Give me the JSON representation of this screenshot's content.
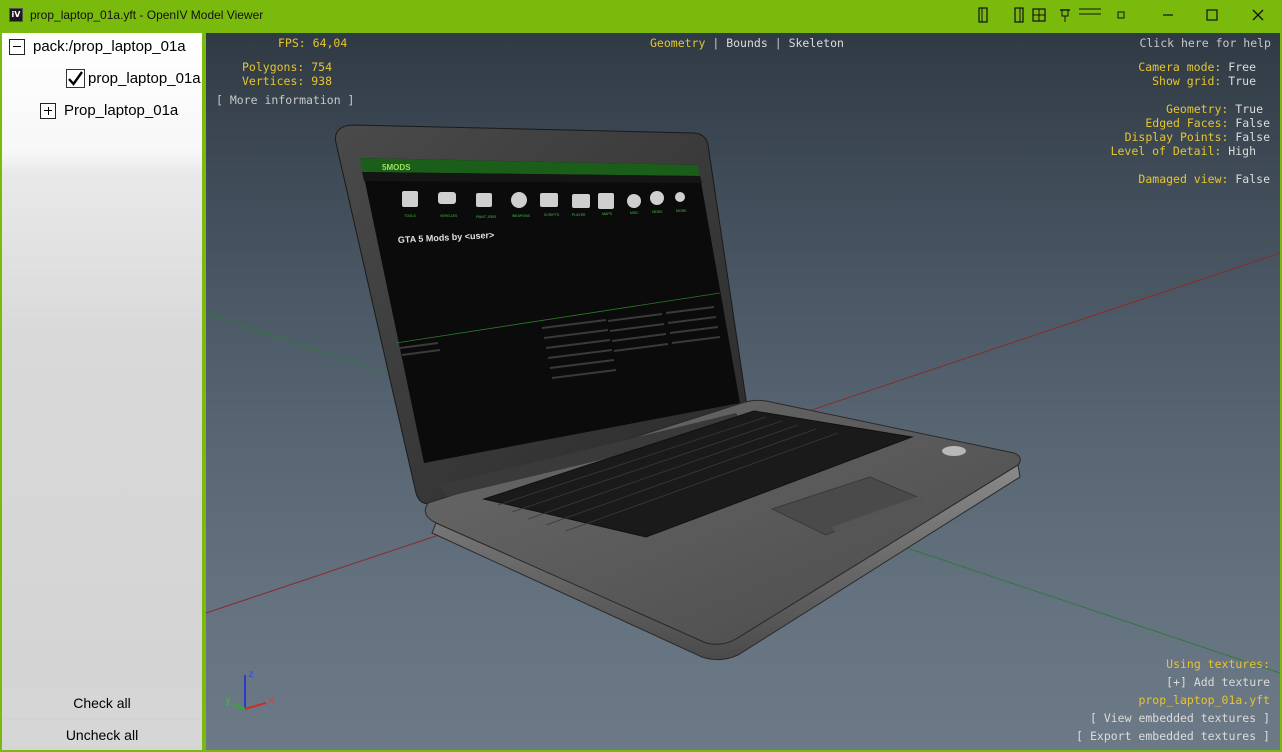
{
  "window": {
    "title": "prop_laptop_01a.yft - OpenIV Model Viewer",
    "app_icon_text": "iV",
    "accent_color": "#7aba0d"
  },
  "tree": {
    "root": "pack:/prop_laptop_01a",
    "model": "prop_laptop_01a",
    "fragment": "Prop_laptop_01a"
  },
  "left_buttons": {
    "check_all": "Check all",
    "uncheck_all": "Uncheck all"
  },
  "hud": {
    "fps_label": "FPS:",
    "fps_value": "64,04",
    "polygons_label": "Polygons:",
    "polygons_value": "754",
    "vertices_label": "Vertices:",
    "vertices_value": "938",
    "more_info": "[ More information ]",
    "modes": {
      "geometry": "Geometry",
      "bounds": "Bounds",
      "skeleton": "Skeleton",
      "separator": "|"
    },
    "help": "Click here for help",
    "settings": [
      {
        "label": "Camera mode:",
        "value": "Free"
      },
      {
        "label": "Show grid:",
        "value": "True"
      },
      {
        "label": "Geometry:",
        "value": "True"
      },
      {
        "label": "Edged Faces:",
        "value": "False"
      },
      {
        "label": "Display Points:",
        "value": "False"
      },
      {
        "label": "Level of Detail:",
        "value": "High"
      },
      {
        "label": "Damaged view:",
        "value": "False"
      }
    ],
    "textures": {
      "heading": "Using textures:",
      "add": "[+] Add texture",
      "file": "prop_laptop_01a.yft",
      "view": "[ View embedded textures ]",
      "export": "[ Export embedded textures ]"
    },
    "axes": {
      "x": "x",
      "y": "y",
      "z": "z"
    }
  },
  "screen_content": {
    "site_logo": "5MODS",
    "heading": "GTA 5 Mods by <user>",
    "categories": [
      "TOOLS",
      "VEHICLES",
      "PAINT JOBS",
      "WEAPONS",
      "SCRIPTS",
      "PLAYER",
      "MAPS",
      "MISC",
      "NEWS",
      "MORE"
    ]
  }
}
